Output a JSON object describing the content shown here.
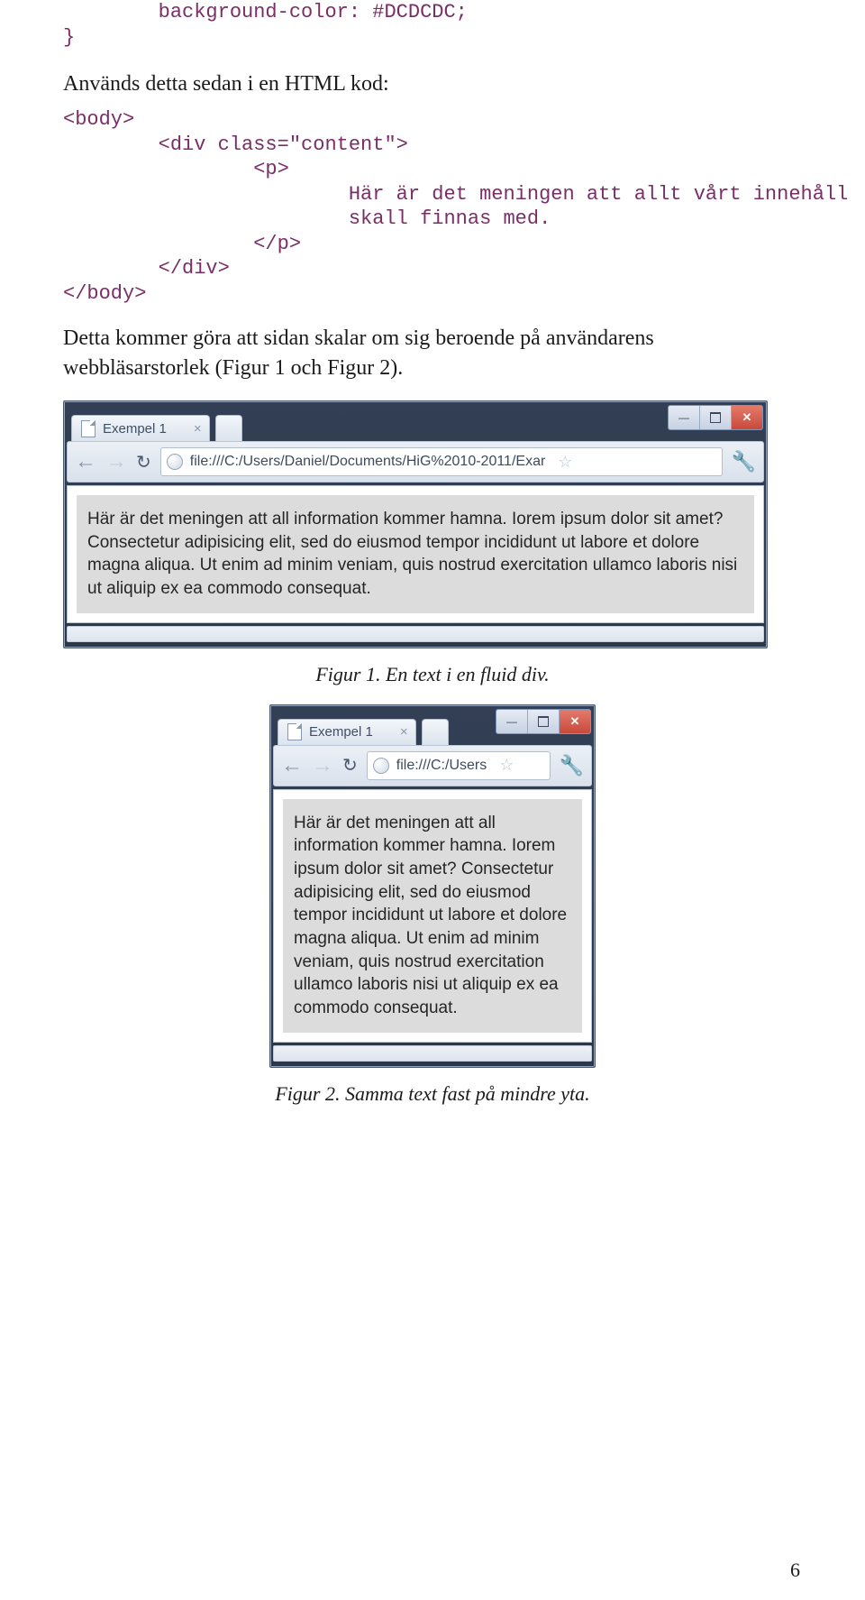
{
  "codeLine1": "        background-color: #DCDCDC;",
  "codeLine2": "}",
  "para1": "Används detta sedan i en HTML kod:",
  "codeB1": "<body>",
  "codeB2": "        <div class=\"content\">",
  "codeB3": "                <p>",
  "codeB4": "                        Här är det meningen att allt vårt innehåll",
  "codeB5": "                        skall finnas med.",
  "codeB6": "                </p>",
  "codeB7": "        </div>",
  "codeB8": "</body>",
  "para2": "Detta kommer göra att sidan skalar om sig beroende på användarens webbläsarstorlek (Figur 1 och Figur 2).",
  "caption1": "Figur 1. En text i en fluid div.",
  "caption2": "Figur 2. Samma text fast på mindre yta.",
  "pageNumber": "6",
  "figure1": {
    "tabTitle": "Exempel 1",
    "url": "file:///C:/Users/Daniel/Documents/HiG%2010-2011/Exar",
    "content": "Här är det meningen att all information kommer hamna. Iorem ipsum dolor sit amet? Consectetur adipisicing elit, sed do eiusmod tempor incididunt ut labore et dolore magna aliqua. Ut enim ad minim veniam, quis nostrud exercitation ullamco laboris nisi ut aliquip ex ea commodo consequat."
  },
  "figure2": {
    "tabTitle": "Exempel 1",
    "url": "file:///C:/Users",
    "content": "Här är det meningen att all information kommer hamna. Iorem ipsum dolor sit amet? Consectetur adipisicing elit, sed do eiusmod tempor incididunt ut labore et dolore magna aliqua. Ut enim ad minim veniam, quis nostrud exercitation ullamco laboris nisi ut aliquip ex ea commodo consequat."
  }
}
